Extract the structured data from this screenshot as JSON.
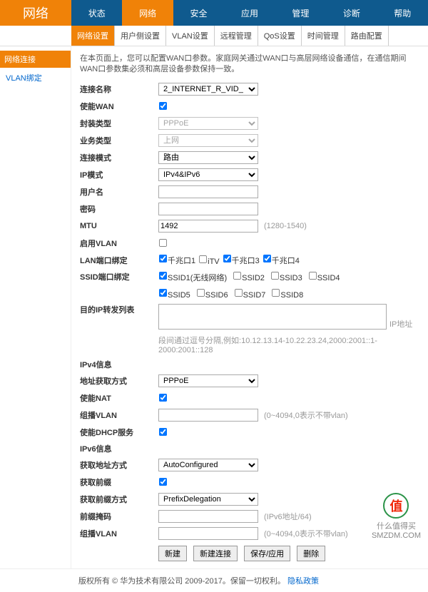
{
  "brand": "网络",
  "tabs": [
    "状态",
    "网络",
    "安全",
    "应用",
    "管理",
    "诊断",
    "帮助"
  ],
  "activeTab": 1,
  "subtabs": [
    "网络设置",
    "用户侧设置",
    "VLAN设置",
    "远程管理",
    "QoS设置",
    "时间管理",
    "路由配置"
  ],
  "activeSubtab": 0,
  "sidebar": {
    "heading": "网络连接",
    "items": [
      "VLAN绑定"
    ]
  },
  "intro": "在本页面上，您可以配置WAN口参数。家庭网关通过WAN口与高层网络设备通信，在通信期间WAN口参数集必须和高层设备参数保持一致。",
  "form": {
    "link_name_label": "连接名称",
    "link_name_value": "2_INTERNET_R_VID_",
    "enable_wan_label": "使能WAN",
    "enable_wan_value": true,
    "encapsulation_label": "封装类型",
    "encapsulation_value": "PPPoE",
    "service_type_label": "业务类型",
    "service_type_value": "上网",
    "conn_mode_label": "连接模式",
    "conn_mode_value": "路由",
    "ip_mode_label": "IP模式",
    "ip_mode_value": "IPv4&IPv6",
    "username_label": "用户名",
    "username_value": "",
    "password_label": "密码",
    "password_value": "",
    "mtu_label": "MTU",
    "mtu_value": "1492",
    "mtu_hint": "(1280-1540)",
    "enable_vlan_label": "启用VLAN",
    "enable_vlan_value": false,
    "lan_bind_label": "LAN端口绑定",
    "lan_bind_opts": [
      {
        "label": "千兆口1",
        "checked": true
      },
      {
        "label": "iTV",
        "checked": false
      },
      {
        "label": "千兆口3",
        "checked": true
      },
      {
        "label": "千兆口4",
        "checked": true
      }
    ],
    "ssid_bind_label": "SSID端口绑定",
    "ssid_bind_opts_row1": [
      {
        "label": "SSID1(无线网络)",
        "checked": true
      },
      {
        "label": "SSID2",
        "checked": false
      },
      {
        "label": "SSID3",
        "checked": false
      },
      {
        "label": "SSID4",
        "checked": false
      }
    ],
    "ssid_bind_opts_row2": [
      {
        "label": "SSID5",
        "checked": true
      },
      {
        "label": "SSID6",
        "checked": false
      },
      {
        "label": "SSID7",
        "checked": false
      },
      {
        "label": "SSID8",
        "checked": false
      }
    ],
    "dst_ip_label": "目的IP转发列表",
    "dst_ip_value": "",
    "dst_ip_suffix": "IP地址",
    "dst_ip_hint": "段间通过逗号分隔,例如:10.12.13.14-10.22.23.24,2000:2001::1-2000:2001::128",
    "ipv4_section": "IPv4信息",
    "addr_mode_label": "地址获取方式",
    "addr_mode_value": "PPPoE",
    "enable_nat_label": "使能NAT",
    "enable_nat_value": true,
    "mcast_vlan4_label": "组播VLAN",
    "mcast_vlan4_value": "",
    "mcast_vlan4_hint": "(0~4094,0表示不带vlan)",
    "enable_dhcp_label": "使能DHCP服务",
    "enable_dhcp_value": true,
    "ipv6_section": "IPv6信息",
    "addr_mode6_label": "获取地址方式",
    "addr_mode6_value": "AutoConfigured",
    "prefix6_label": "获取前缀",
    "prefix6_value": true,
    "prefix_mode6_label": "获取前缀方式",
    "prefix_mode6_value": "PrefixDelegation",
    "prefix_mask6_label": "前缀掩码",
    "prefix_mask6_value": "",
    "prefix_mask6_hint": "(IPv6地址/64)",
    "mcast_vlan6_label": "组播VLAN",
    "mcast_vlan6_value": "",
    "mcast_vlan6_hint": "(0~4094,0表示不带vlan)"
  },
  "buttons": {
    "new": "新建",
    "new_conn": "新建连接",
    "save": "保存/应用",
    "delete": "删除"
  },
  "footer": {
    "copyright": "版权所有 © 华为技术有限公司 2009-2017。保留一切权利。",
    "link": "隐私政策"
  },
  "watermark": {
    "glyph": "值",
    "line1": "什么值得买",
    "line2": "SMZDM.COM"
  }
}
